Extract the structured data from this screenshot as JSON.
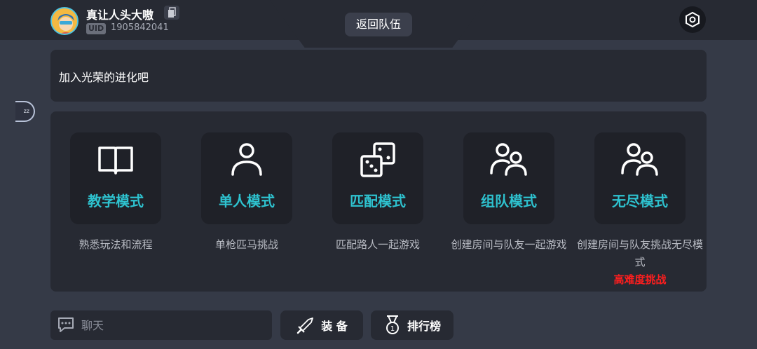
{
  "user": {
    "name": "真让人头大嗷",
    "uid_label": "UID",
    "uid": "1905842041"
  },
  "header": {
    "return_team": "返回队伍"
  },
  "side_handle_text": "zz",
  "announcement": "加入光荣的进化吧",
  "modes": [
    {
      "title": "教学模式",
      "desc": "熟悉玩法和流程",
      "icon": "book-icon"
    },
    {
      "title": "单人模式",
      "desc": "单枪匹马挑战",
      "icon": "person-icon"
    },
    {
      "title": "匹配模式",
      "desc": "匹配路人一起游戏",
      "icon": "dice-icon"
    },
    {
      "title": "组队模式",
      "desc": "创建房间与队友一起游戏",
      "icon": "team-icon"
    },
    {
      "title": "无尽模式",
      "desc": "创建房间与队友挑战无尽模式",
      "warn": "高难度挑战",
      "icon": "team-icon"
    }
  ],
  "chat": {
    "placeholder": "聊天"
  },
  "buttons": {
    "equipment": "装 备",
    "leaderboard": "排行榜"
  },
  "colors": {
    "accent": "#2ec2cf",
    "warning": "#ff1e1e",
    "panel": "#272a33",
    "background": "#353a47"
  }
}
